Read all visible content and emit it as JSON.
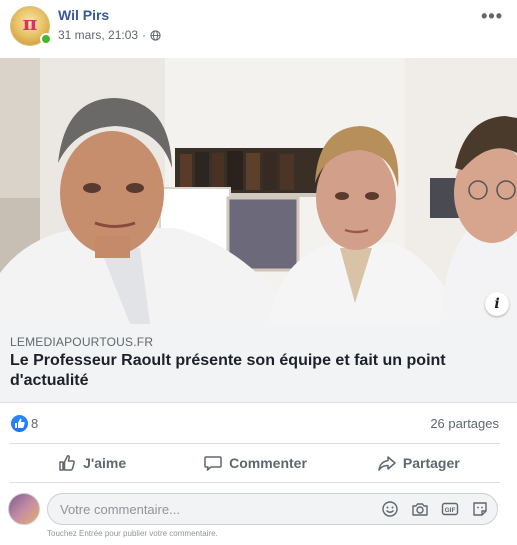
{
  "post": {
    "author": "Wil Pirs",
    "timestamp": "31 mars, 21:03",
    "avatar_icon": "pi-logo-avatar",
    "privacy_icon": "globe-icon",
    "more_icon": "more-options-icon"
  },
  "link": {
    "domain": "LEMEDIAPOURTOUS.FR",
    "title": "Le Professeur Raoult présente son équipe et fait un point d'actualité",
    "info_icon": "info-icon"
  },
  "stats": {
    "likes": "8",
    "shares": "26 partages",
    "reaction_icon": "like-reaction-icon"
  },
  "actions": {
    "like": "J'aime",
    "comment": "Commenter",
    "share": "Partager"
  },
  "comment_box": {
    "placeholder": "Votre commentaire...",
    "hint": "Touchez Entrée pour publier votre commentaire.",
    "icons": [
      "emoji-icon",
      "camera-icon",
      "gif-icon",
      "sticker-icon"
    ]
  },
  "colors": {
    "author_link": "#385898",
    "like_blue": "#1877f2",
    "online_green": "#42b72a",
    "secondary_text": "#606770"
  }
}
